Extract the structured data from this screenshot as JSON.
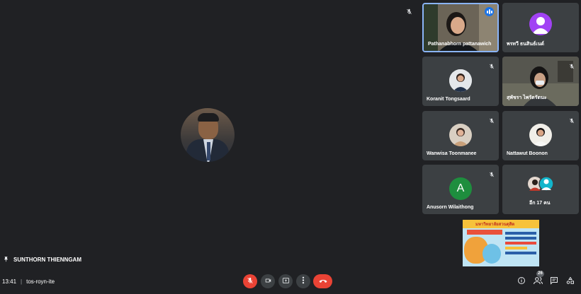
{
  "stage": {
    "presenter_name": "SUNTHORN THIENNGAM"
  },
  "participants": [
    {
      "name": "Pathanabhorn pattanawich",
      "speaking": true
    },
    {
      "name": "พรทวี ธนสินธ์เนต์",
      "muted": true,
      "avatar_color": "#a142f4"
    },
    {
      "name": "Koranit Tongsaard",
      "muted": true
    },
    {
      "name": "สุพัชรา ไพรัตรัตนะ",
      "muted": true
    },
    {
      "name": "Wanwisa Toonmanee",
      "muted": true
    },
    {
      "name": "Nattawut Boonon",
      "muted": true
    },
    {
      "name": "Anusorn Wilaithong",
      "muted": true,
      "initial": "A",
      "avatar_color": "#1e8e3e"
    }
  ],
  "overflow_tile": {
    "label": "อีก 17 คน"
  },
  "shared_poster": {
    "banner_text": "มหาวิทยาลัยสวนดุสิต"
  },
  "bottom_bar": {
    "time": "13:41",
    "separator": "|",
    "meeting_code": "tos-royn-ite",
    "people_count": "26"
  },
  "colors": {
    "background": "#202124",
    "tile": "#3c4043",
    "danger": "#ea4335",
    "speaking": "#1a73e8"
  }
}
